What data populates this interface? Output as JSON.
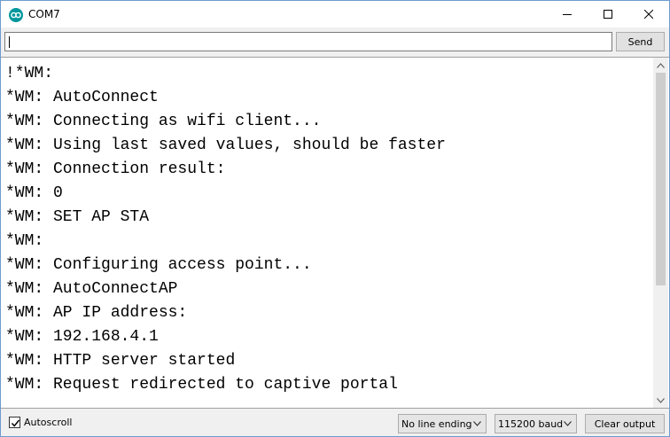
{
  "window": {
    "title": "COM7"
  },
  "send": {
    "input_value": "",
    "button_label": "Send"
  },
  "output": {
    "lines": [
      "!*WM:",
      "*WM: AutoConnect",
      "*WM: Connecting as wifi client...",
      "*WM: Using last saved values, should be faster",
      "*WM: Connection result:",
      "*WM: 0",
      "*WM: SET AP STA",
      "*WM:",
      "*WM: Configuring access point...",
      "*WM: AutoConnectAP",
      "*WM: AP IP address:",
      "*WM: 192.168.4.1",
      "*WM: HTTP server started",
      "*WM: Request redirected to captive portal"
    ]
  },
  "footer": {
    "autoscroll_label": "Autoscroll",
    "autoscroll_checked": true,
    "line_ending_selected": "No line ending",
    "baud_selected": "115200 baud",
    "clear_button_label": "Clear output"
  },
  "colors": {
    "app_icon": "#00979c",
    "window_border": "#6d9bd1"
  },
  "icons": {
    "app": "arduino-infinity-icon",
    "minimize": "minimize-icon",
    "maximize": "maximize-icon",
    "close": "close-icon",
    "chevron": "chevron-down-icon"
  }
}
